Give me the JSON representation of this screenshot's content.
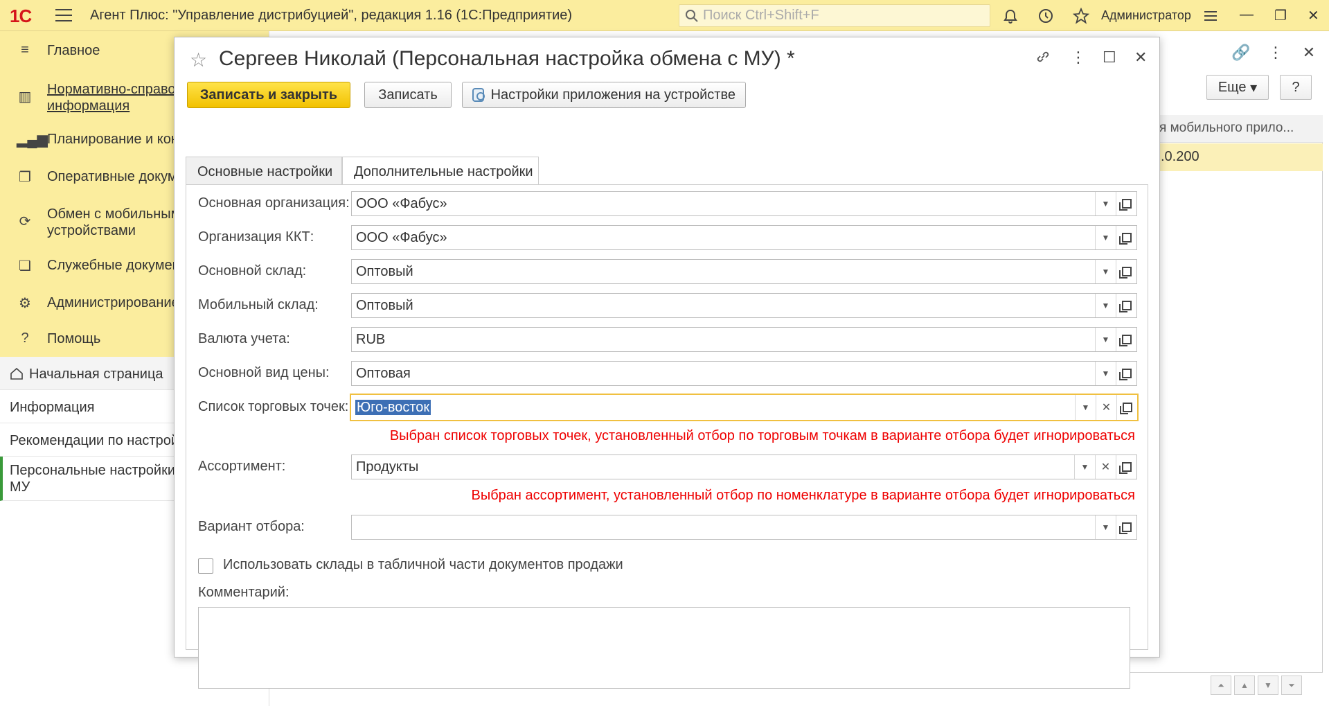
{
  "app": {
    "logo": "1С",
    "title": "Агент Плюс: \"Управление дистрибуцией\", редакция 1.16  (1С:Предприятие)",
    "search_placeholder": "Поиск Ctrl+Shift+F",
    "user": "Администратор",
    "accent_color": "#fbed9e"
  },
  "sidebar": {
    "items": [
      {
        "label": "Главное",
        "icon": "menu-lines-icon"
      },
      {
        "label_line1": "Нормативно-справо",
        "label_line2": "информация",
        "icon": "catalog-icon"
      },
      {
        "label": "Планирование и кон",
        "icon": "chart-icon"
      },
      {
        "label": "Оперативные докум",
        "icon": "documents-icon"
      },
      {
        "label_line1": "Обмен с мобильным",
        "label_line2": "устройствами",
        "icon": "sync-icon"
      },
      {
        "label": "Служебные докумен",
        "icon": "service-docs-icon"
      },
      {
        "label": "Администрирование",
        "icon": "gear-icon"
      },
      {
        "label": "Помощь",
        "icon": "help-icon"
      }
    ],
    "open_windows": [
      {
        "label": "Начальная страница"
      },
      {
        "label": "Информация"
      },
      {
        "label": "Рекомендации по настрой"
      },
      {
        "label_line1": "Персональные настройки",
        "label_line2": "МУ"
      }
    ]
  },
  "background_form": {
    "more_button": "Еще",
    "help_button": "?",
    "column_header": "я мобильного прило...",
    "cell_value": ".0.200"
  },
  "modal": {
    "title": "Сергеев Николай (Персональная настройка обмена с МУ) *",
    "buttons": {
      "save_close": "Записать и закрыть",
      "save": "Записать",
      "device_settings": "Настройки приложения на устройстве"
    },
    "tabs": [
      {
        "label": "Основные настройки",
        "active": false
      },
      {
        "label": "Дополнительные настройки",
        "active": true
      }
    ],
    "fields": [
      {
        "label": "Основная организация:",
        "value": "ООО «Фабус»"
      },
      {
        "label": "Организация ККТ:",
        "value": "ООО «Фабус»"
      },
      {
        "label": "Основной склад:",
        "value": "Оптовый"
      },
      {
        "label": "Мобильный склад:",
        "value": "Оптовый"
      },
      {
        "label": "Валюта учета:",
        "value": "RUB"
      },
      {
        "label": "Основной вид цены:",
        "value": "Оптовая"
      },
      {
        "label": "Список торговых точек:",
        "value": "Юго-восток"
      },
      {
        "label": "Ассортимент:",
        "value": "Продукты"
      },
      {
        "label": "Вариант отбора:",
        "value": ""
      }
    ],
    "warnings": {
      "points": "Выбран список торговых точек, установленный отбор по торговым точкам в варианте отбора будет игнорироваться",
      "assortment": "Выбран ассортимент, установленный отбор по номенклатуре в варианте отбора будет игнорироваться",
      "color": "#e00000"
    },
    "checkbox_label": "Использовать склады в табличной части документов продажи",
    "checkbox_checked": false,
    "comment_label": "Комментарий:",
    "comment_value": ""
  }
}
